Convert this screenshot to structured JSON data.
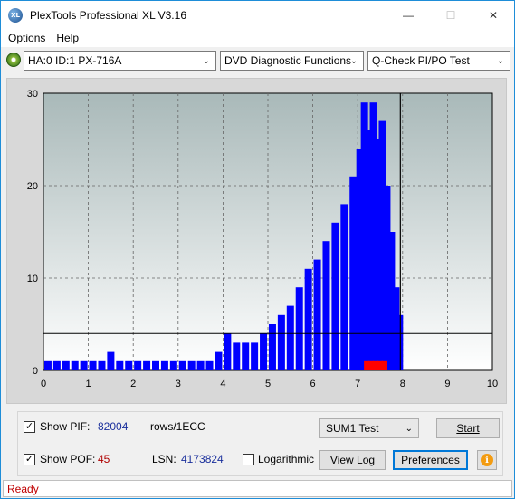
{
  "window": {
    "title": "PlexTools Professional XL V3.16",
    "logo_text": "XL",
    "minimize_glyph": "—",
    "maximize_glyph": "☐",
    "close_glyph": "✕"
  },
  "menu": {
    "options_first": "O",
    "options_rest": "ptions",
    "help_first": "H",
    "help_rest": "elp"
  },
  "toolbar": {
    "drive": "HA:0 ID:1  PX-716A",
    "function": "DVD Diagnostic Functions",
    "test": "Q-Check PI/PO Test",
    "dropdown_glyph": "⌄"
  },
  "controls": {
    "show_pif_label": "Show PIF:",
    "pif_value": "82004",
    "pif_unit": "rows/1ECC",
    "show_pof_label": "Show POF:",
    "pof_value": "45",
    "lsn_label": "LSN:",
    "lsn_value": "4173824",
    "logarithmic_label": "Logarithmic",
    "test_select": "SUM1 Test",
    "start_label": "Start",
    "view_log_label": "View Log",
    "preferences_label": "Preferences",
    "check_glyph": "✓",
    "info_glyph": "i"
  },
  "status": {
    "text": "Ready"
  },
  "chart_data": {
    "type": "bar",
    "xlim": [
      0,
      10
    ],
    "ylim": [
      0,
      30
    ],
    "x_ticks": [
      "0",
      "1",
      "2",
      "3",
      "4",
      "5",
      "6",
      "7",
      "8",
      "9",
      "10"
    ],
    "y_ticks": [
      "0",
      "10",
      "20",
      "30"
    ],
    "threshold_line": 4,
    "vertical_marker": 7.95,
    "grid": true,
    "colors": {
      "pif": "#0000ff",
      "pof": "#ff0000",
      "plot_bg_top": "#a9b9b9",
      "plot_bg_bottom": "#ffffff"
    },
    "series": [
      {
        "name": "PIF",
        "x": [
          0.1,
          0.3,
          0.5,
          0.7,
          0.9,
          1.1,
          1.3,
          1.5,
          1.7,
          1.9,
          2.1,
          2.3,
          2.5,
          2.7,
          2.9,
          3.1,
          3.3,
          3.5,
          3.7,
          3.9,
          4.1,
          4.3,
          4.5,
          4.7,
          4.9,
          5.1,
          5.3,
          5.5,
          5.7,
          5.9,
          6.1,
          6.3,
          6.5,
          6.7,
          6.9,
          7.05,
          7.15,
          7.25,
          7.35,
          7.45,
          7.55,
          7.65,
          7.75,
          7.85,
          7.93
        ],
        "values": [
          1,
          1,
          1,
          1,
          1,
          1,
          1,
          2,
          1,
          1,
          1,
          1,
          1,
          1,
          1,
          1,
          1,
          1,
          1,
          2,
          4,
          3,
          3,
          3,
          4,
          5,
          6,
          7,
          9,
          11,
          12,
          14,
          16,
          18,
          21,
          24,
          29,
          26,
          29,
          25,
          27,
          20,
          15,
          9,
          6
        ]
      },
      {
        "name": "POF",
        "x": [
          7.2,
          7.3,
          7.4,
          7.5,
          7.6
        ],
        "values": [
          1,
          1,
          1,
          1,
          1
        ]
      }
    ]
  }
}
